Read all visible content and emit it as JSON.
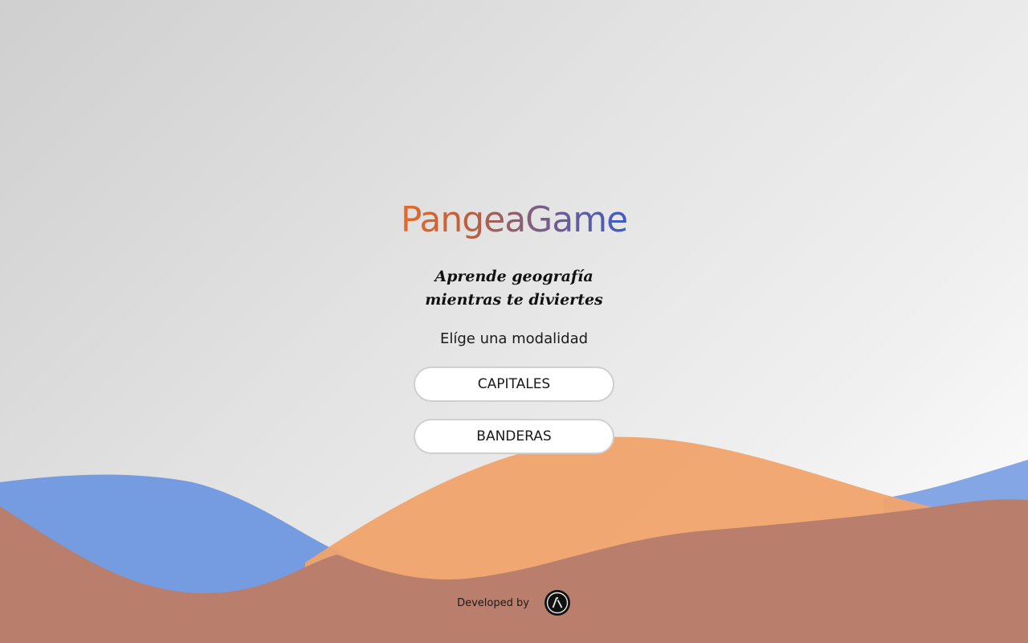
{
  "app": {
    "title": "PangeaGame"
  },
  "hero": {
    "tagline_line1": "Aprende geografía",
    "tagline_line2": "mientras te diviertes",
    "prompt": "Elíge una modalidad"
  },
  "modes": {
    "capitales_label": "CAPITALES",
    "banderas_label": "BANDERAS"
  },
  "footer": {
    "developed_by": "Developed by",
    "logo_icon": "developer-logo-icon"
  },
  "colors": {
    "title_gradient_start": "#e8692a",
    "title_gradient_end": "#3f5bc4",
    "wave_blue": "#6f97e0",
    "wave_orange": "#f0a36c",
    "wave_brown": "#b97f6c"
  }
}
